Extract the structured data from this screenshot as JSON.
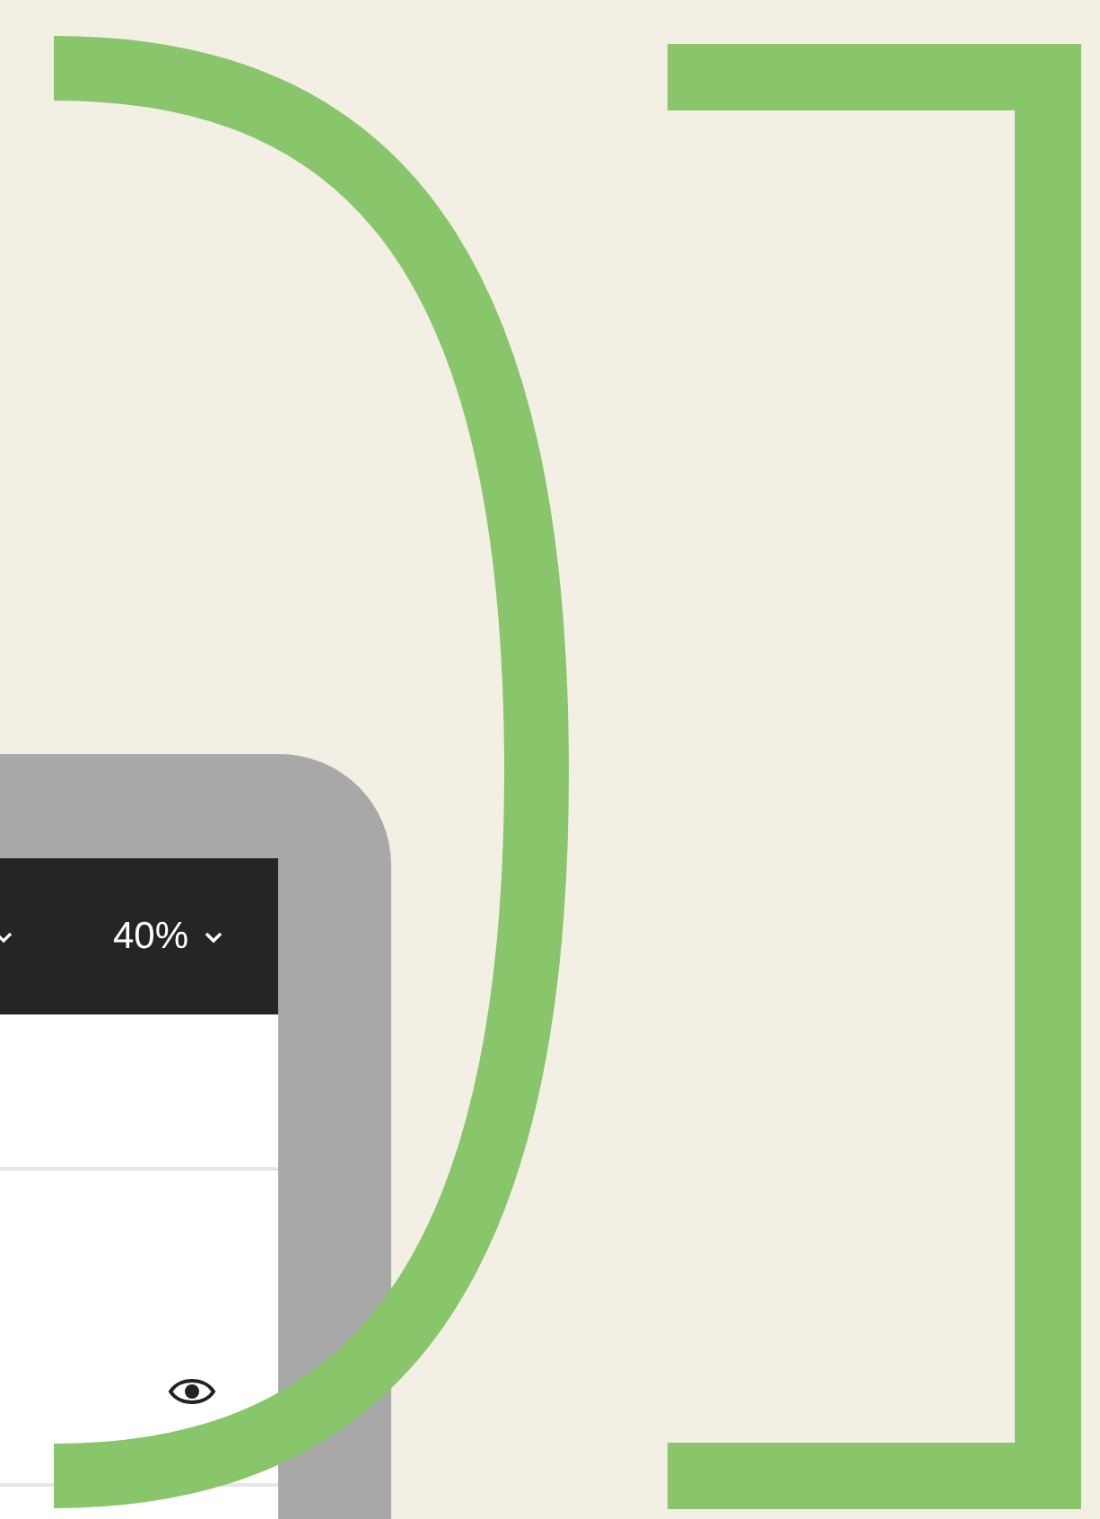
{
  "toolbar": {
    "zoom": "40%"
  }
}
